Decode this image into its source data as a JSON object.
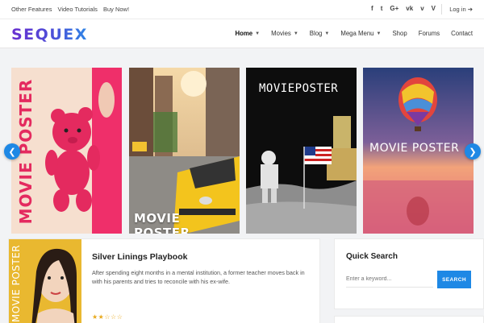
{
  "topbar": {
    "links": [
      "Other Features",
      "Video Tutorials",
      "Buy Now!"
    ],
    "social_icons": [
      "facebook-icon",
      "twitter-icon",
      "google-plus-icon",
      "vk-icon",
      "vimeo-icon",
      "vine-icon"
    ],
    "social_glyphs": [
      "f",
      "t",
      "G+",
      "vk",
      "v",
      "V"
    ],
    "login_label": "Log in ➔"
  },
  "header": {
    "logo_text": "SEQUEX",
    "nav": [
      {
        "label": "Home",
        "dropdown": true
      },
      {
        "label": "Movies",
        "dropdown": true
      },
      {
        "label": "Blog",
        "dropdown": true
      },
      {
        "label": "Mega Menu",
        "dropdown": true
      },
      {
        "label": "Shop",
        "dropdown": false
      },
      {
        "label": "Forums",
        "dropdown": false
      },
      {
        "label": "Contact",
        "dropdown": false
      }
    ]
  },
  "slider": {
    "cards": [
      {
        "poster_text": "MOVIE POSTER",
        "theme": "teddy-bear"
      },
      {
        "poster_text": "MOVIE POSTER",
        "theme": "city-taxi"
      },
      {
        "poster_text": "MOVIEPOSTER",
        "theme": "moon-landing"
      },
      {
        "poster_text": "MOVIE POSTER",
        "theme": "hot-air-balloon"
      }
    ],
    "prev_icon": "chevron-left-icon",
    "next_icon": "chevron-right-icon"
  },
  "featured": {
    "poster_text": "MOVIE POSTER",
    "title": "Silver Linings Playbook",
    "description": "After spending eight months in a mental institution, a former teacher moves back in with his parents and tries to reconcile with his ex-wife.",
    "rating": 2,
    "rating_max": 5,
    "stars": "★★☆☆☆"
  },
  "sidebar": {
    "search_title": "Quick Search",
    "search_placeholder": "Enter a keyword...",
    "search_button": "SEARCH"
  },
  "colors": {
    "accent": "#1e88e5",
    "logo_start": "#6a2fd0",
    "logo_end": "#2f86e6",
    "star": "#e8a91c"
  }
}
